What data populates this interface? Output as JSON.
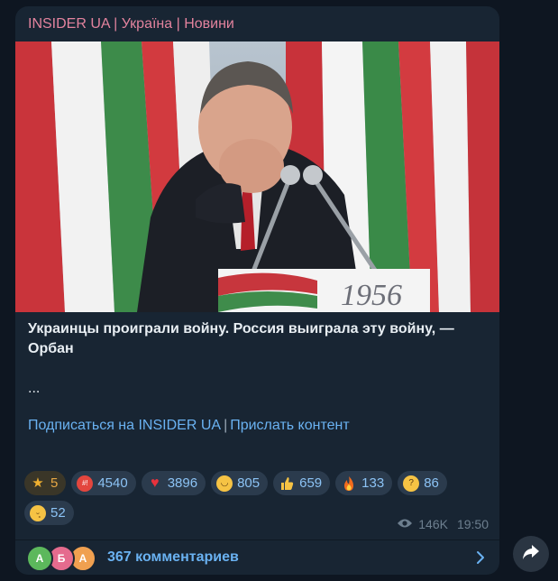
{
  "channel": {
    "title": "INSIDER UA | Україна | Новини"
  },
  "post": {
    "headline": "Украинцы проиграли войну. Россия выиграла эту войну, — Орбан",
    "ellipsis": "...",
    "podium_text": "1956"
  },
  "links": {
    "subscribe": "Подписаться на INSIDER UA",
    "separator": "|",
    "send_content": "Прислать контент"
  },
  "reactions": [
    {
      "icon": "star-icon",
      "count": "5"
    },
    {
      "icon": "angry-face-icon",
      "count": "4540"
    },
    {
      "icon": "heart-icon",
      "count": "3896"
    },
    {
      "icon": "grinning-face-icon",
      "count": "805"
    },
    {
      "icon": "thumbs-up-icon",
      "count": "659"
    },
    {
      "icon": "fire-icon",
      "count": "133"
    },
    {
      "icon": "thinking-face-icon",
      "count": "86"
    },
    {
      "icon": "crying-face-icon",
      "count": "52"
    }
  ],
  "meta": {
    "views": "146K",
    "time": "19:50"
  },
  "comments": {
    "avatars": [
      {
        "letter": "А",
        "color": "#5cb85c"
      },
      {
        "letter": "Б",
        "color": "#e56b8e"
      },
      {
        "letter": "А",
        "color": "#f0a050"
      }
    ],
    "label": "367 комментариев"
  },
  "colors": {
    "background": "#0e1621",
    "bubble": "#182533",
    "channel_name": "#e3839e",
    "link": "#6ab2f2"
  }
}
